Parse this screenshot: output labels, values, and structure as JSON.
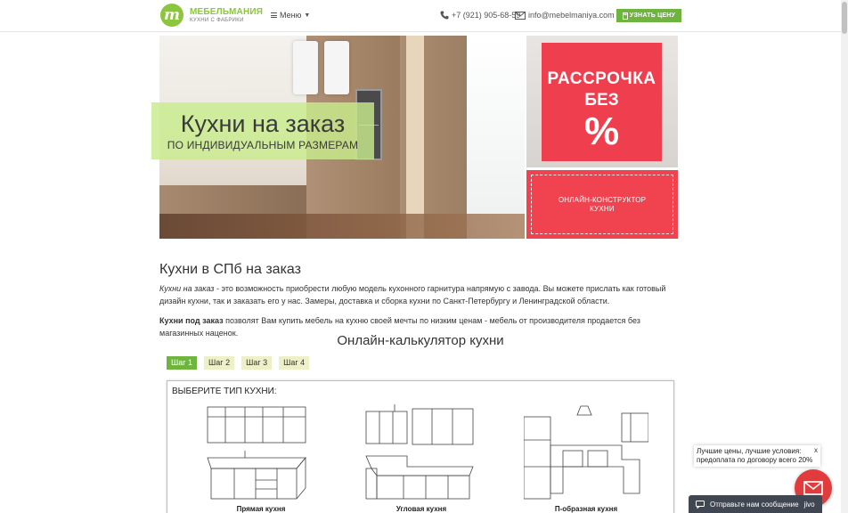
{
  "header": {
    "logo_letter": "m",
    "logo_name": "МЕБЕЛЬМАНИЯ",
    "logo_sub": "КУХНИ С ФАБРИКИ",
    "menu_label": "Меню",
    "phone": "+7 (921) 905-68-59",
    "email": "info@mebelmaniya.com",
    "price_button": "УЗНАТЬ ЦЕНУ"
  },
  "hero": {
    "title": "Кухни на заказ",
    "subtitle": "ПО ИНДИВИДУАЛЬНЫМ РАЗМЕРАМ"
  },
  "promo": {
    "line1": "РАССРОЧКА",
    "line2": "БЕЗ",
    "percent": "%",
    "constructor_line1": "ОНЛАЙН-КОНСТРУКТОР",
    "constructor_line2": "КУХНИ"
  },
  "content": {
    "heading": "Кухни в СПб на заказ",
    "p1_em": "Кухни на заказ",
    "p1_rest": " - это возможность приобрести любую модель кухонного гарнитура напрямую с завода. Вы можете прислать как готовый дизайн кухни, так и заказать его у нас. Замеры, доставка и сборка кухни по Санкт-Петербургу и Ленинградской области.",
    "p2_strong": "Кухни под заказ",
    "p2_rest": " позволят Вам купить мебель на кухню своей мечты по низким ценам - мебель от производителя продается без магазинных наценок."
  },
  "calculator": {
    "title": "Онлайн-калькулятор кухни",
    "steps": [
      "Шаг 1",
      "Шаг 2",
      "Шаг 3",
      "Шаг 4"
    ],
    "active_step": 1,
    "question": "ВЫБЕРИТЕ ТИП КУХНИ:",
    "types": [
      "Прямая кухня",
      "Угловая кухня",
      "П-образная кухня"
    ]
  },
  "chat": {
    "notice_text": "Лучшие цены, лучшие условия: предоплата по договору всего 20%",
    "notice_close": "x",
    "bar_text": "Отправьте нам сообщение",
    "brand": "jivo"
  },
  "colors": {
    "brand_green": "#8cc63f",
    "button_green": "#6fb43f",
    "promo_red": "#ef3e4e",
    "chat_dark": "#404652"
  }
}
